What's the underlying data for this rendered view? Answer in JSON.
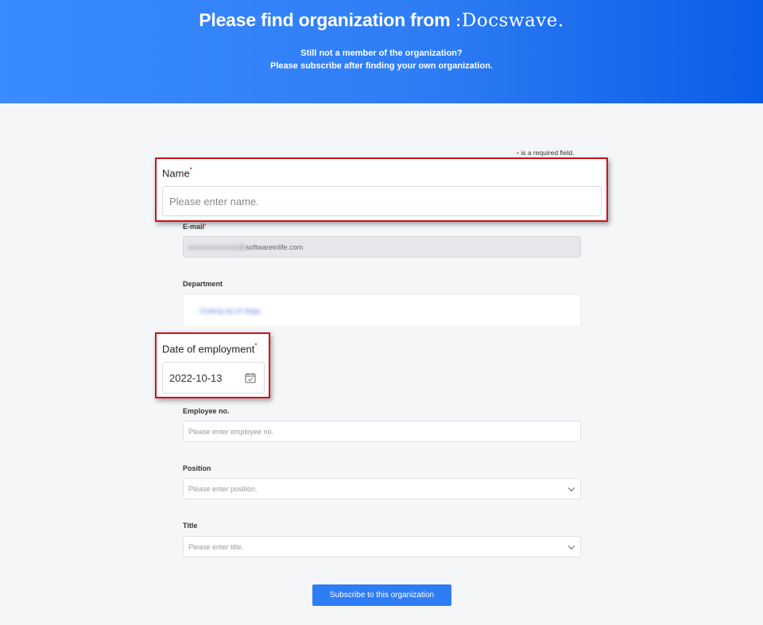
{
  "hero": {
    "title_prefix": "Please find organization from ",
    "brand": ":Docswave.",
    "sub_line1": "Still not a member of the organization?",
    "sub_line2": "Please subscribe after finding your own organization."
  },
  "required_note": {
    "marker": "•",
    "text": " is a required field."
  },
  "form": {
    "name": {
      "label": "Name",
      "required_marker": "•",
      "placeholder": "Please enter name."
    },
    "email": {
      "label": "E-mail",
      "required_marker": "•",
      "value_blurred": "xxxxxxxxxxxxxx@",
      "value_domain": "softwareinlife.com"
    },
    "department": {
      "label": "Department",
      "value_blurred": "Ordeng tej ch ttega"
    },
    "date_of_employment": {
      "label": "Date of employment",
      "required_marker": "•",
      "value": "2022-10-13"
    },
    "employee_no": {
      "label": "Employee no.",
      "placeholder": "Please enter employee no."
    },
    "position": {
      "label": "Position",
      "placeholder": "Please enter position."
    },
    "title": {
      "label": "Title",
      "placeholder": "Please enter title."
    }
  },
  "submit_label": "Subscribe to this organization",
  "colors": {
    "primary": "#2f7df5",
    "highlight_border": "#d0101c",
    "required": "#e8542f"
  },
  "icons": {
    "calendar": "calendar-check-icon",
    "chevron": "chevron-down-icon"
  }
}
